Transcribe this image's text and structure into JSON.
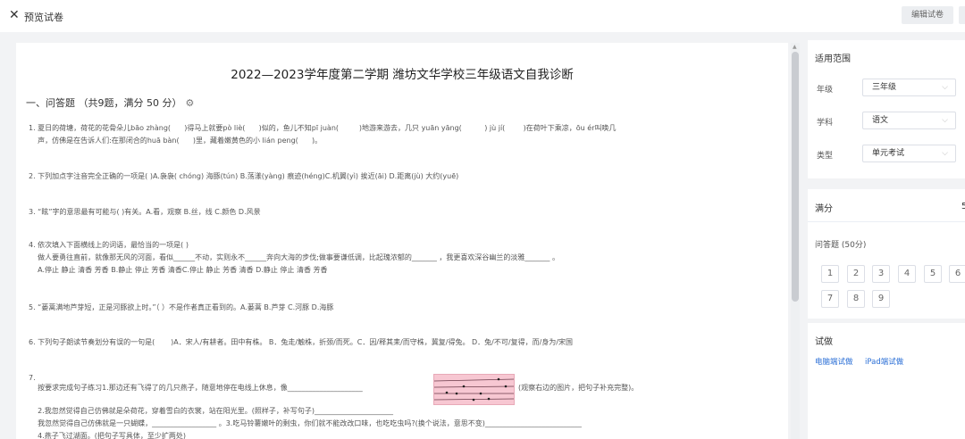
{
  "header": {
    "close_icon": "close-icon",
    "title": "预览试卷",
    "edit_button": "编辑试卷"
  },
  "paper": {
    "title": "2022—2023学年度第二学期 潍坊文华学校三年级语文自我诊断",
    "section_title": "一、问答题 （共9题，满分 50 分）",
    "questions": [
      "1. 夏日的荷塘，荷花的花骨朵儿bāo zhàng(      )得马上就要pò liè(      )似的，鱼儿不知pī juàn(         )地游来游去，几只 yuān yāng(          ) jù jí(        )在荷叶下乘凉，ōu ér叫唤几\n    声，仿佛是在告诉人们:在那闭合的huā bàn(      )里，藏着嫩黄色的小 lián peng(      )。",
      "2. 下列加点字注音完全正确的一项是( )A.袅袅( chóng) 海豚(tún) B.荡漾(yàng) 痕迹(héng)C.机翼(yì) 挨近(āi) D.距离(jù) 大约(yuē)",
      "3. “眩”字的意思最有可能与( )有关。A.看，观察 B.丝，线 C.颜色 D.风景",
      "4. 依次填入下面横线上的词语，最恰当的一项是( )\n    做人要勇往直前，就像那无风的河面，看似______不动，实则永不______奔向大海的步伐;做事要谦低调，比起瑰浓郁的_______ ，我更喜欢深谷幽兰的淡雅_______ 。\n    A.停止 静止 清香 芳香 B.静止 停止 芳香 清香C.停止 静止 芳香 清香 D.静止 停止 清香 芳香",
      "5. “蒌蒿满地芦芽短，正是河豚欲上时。”（ ）不是作者真正看到的。A.蒌蒿 B.芦芽 C.河豚 D.海豚",
      "6. 下列句子朗读节奏划分有误的一句是(       )A．宋人/有耕者。田中有株。 B．兔走/触株，折颈/而死。C．因/释其耒/而守株，冀复/得兔。 D．兔/不可/复得，而/身为/宋国",
      "7.",
      "    按要求完成句子练习1.那边还有飞得了的几只燕子，随意地停在电线上休息，像_____________________",
      "(观察右边的图片，把句子补充完整)。",
      "    2.我忽然觉得自己仿佛就是朵荷花，穿着雪白的衣裳，站在阳光里。(照样子，补写句子)______________________\n    我忽然觉得自己仿佛就是一只蝴蝶，__________________ 。3.吃马铃薯嫩叶的剩虫，你们就不能改改口味，也吃吃虫吗?(换个说法，意思不变)___________________________\n    4.燕子飞过湖面。(把句子写具体，至少扩两处)"
    ]
  },
  "side": {
    "scope": {
      "title": "适用范围",
      "grade_label": "年级",
      "grade_value": "三年级",
      "subject_label": "学科",
      "subject_value": "语文",
      "type_label": "类型",
      "type_value": "单元考试"
    },
    "score": {
      "title": "满分",
      "value": "5",
      "group_label": "问答题 (50分)",
      "numbers": [
        "1",
        "2",
        "3",
        "4",
        "5",
        "6",
        "7",
        "8",
        "9"
      ]
    },
    "trial": {
      "title": "试做",
      "pc_link": "电脑端试做",
      "ipad_link": "iPad端试做"
    }
  }
}
